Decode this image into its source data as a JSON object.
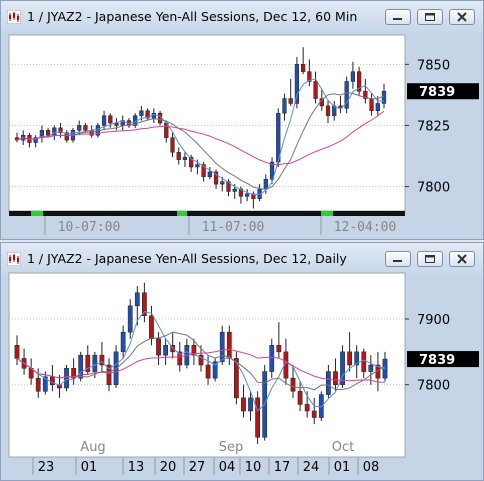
{
  "windows": [
    {
      "title": "1 / JYAZ2 - Japanese Yen-All Sessions, Dec 12, 60 Min",
      "price_labels": [
        "7850",
        "7825",
        "7800"
      ],
      "current_price": "7839",
      "time_labels": [
        "10-07:00",
        "11-07:00",
        "12-04:00"
      ]
    },
    {
      "title": "1 / JYAZ2 - Japanese Yen-All Sessions, Dec 12, Daily",
      "price_labels": [
        "7900",
        "7800"
      ],
      "current_price": "7839",
      "month_labels": [
        "Aug",
        "Sep",
        "Oct"
      ],
      "day_labels": [
        "23",
        "01",
        "13",
        "20",
        "27",
        "04",
        "10",
        "17",
        "24",
        "01",
        "08"
      ]
    }
  ],
  "icons": {
    "minimize": "minimize-icon",
    "maximize": "maximize-icon",
    "close": "close-icon"
  },
  "colors": {
    "up_candle": "#1f4fb0",
    "down_candle": "#b01818",
    "ma_blue": "#5b8fe0",
    "ma_pink": "#d6449a",
    "ma_grey": "#777777",
    "current_price_bg": "#000000",
    "session_green": "#33cc33"
  },
  "chart_data": [
    {
      "type": "candlestick",
      "title": "1 / JYAZ2 - Japanese Yen-All Sessions, Dec 12, 60 Min",
      "ylim": [
        7790,
        7862
      ],
      "yticks": [
        7850,
        7825,
        7800
      ],
      "xticks": [
        "10-07:00",
        "11-07:00",
        "12-04:00"
      ],
      "last": 7839,
      "grid": true,
      "candles": [
        [
          7820,
          7822,
          7818,
          7819
        ],
        [
          7819,
          7823,
          7817,
          7821
        ],
        [
          7821,
          7822,
          7816,
          7818
        ],
        [
          7818,
          7821,
          7816,
          7820
        ],
        [
          7820,
          7825,
          7818,
          7823
        ],
        [
          7823,
          7824,
          7820,
          7821
        ],
        [
          7821,
          7825,
          7819,
          7824
        ],
        [
          7824,
          7826,
          7820,
          7822
        ],
        [
          7822,
          7823,
          7818,
          7819
        ],
        [
          7819,
          7824,
          7818,
          7823
        ],
        [
          7823,
          7827,
          7821,
          7825
        ],
        [
          7825,
          7826,
          7822,
          7823
        ],
        [
          7823,
          7825,
          7820,
          7821
        ],
        [
          7821,
          7826,
          7820,
          7825
        ],
        [
          7825,
          7831,
          7823,
          7829
        ],
        [
          7829,
          7830,
          7824,
          7826
        ],
        [
          7826,
          7828,
          7823,
          7825
        ],
        [
          7825,
          7829,
          7823,
          7827
        ],
        [
          7827,
          7828,
          7824,
          7825
        ],
        [
          7825,
          7830,
          7824,
          7829
        ],
        [
          7829,
          7833,
          7827,
          7831
        ],
        [
          7831,
          7832,
          7827,
          7828
        ],
        [
          7828,
          7832,
          7826,
          7830
        ],
        [
          7830,
          7831,
          7825,
          7826
        ],
        [
          7826,
          7827,
          7818,
          7820
        ],
        [
          7820,
          7822,
          7812,
          7814
        ],
        [
          7814,
          7816,
          7809,
          7811
        ],
        [
          7811,
          7814,
          7808,
          7812
        ],
        [
          7812,
          7813,
          7806,
          7808
        ],
        [
          7808,
          7811,
          7805,
          7809
        ],
        [
          7809,
          7810,
          7802,
          7804
        ],
        [
          7804,
          7808,
          7803,
          7806
        ],
        [
          7806,
          7807,
          7799,
          7801
        ],
        [
          7801,
          7804,
          7798,
          7802
        ],
        [
          7802,
          7803,
          7796,
          7798
        ],
        [
          7798,
          7801,
          7795,
          7799
        ],
        [
          7799,
          7800,
          7793,
          7796
        ],
        [
          7796,
          7799,
          7794,
          7797
        ],
        [
          7797,
          7798,
          7791,
          7795
        ],
        [
          7795,
          7801,
          7794,
          7799
        ],
        [
          7799,
          7805,
          7797,
          7803
        ],
        [
          7803,
          7812,
          7801,
          7810
        ],
        [
          7810,
          7832,
          7808,
          7830
        ],
        [
          7830,
          7838,
          7827,
          7836
        ],
        [
          7836,
          7844,
          7833,
          7834
        ],
        [
          7834,
          7853,
          7832,
          7850
        ],
        [
          7850,
          7857,
          7846,
          7847
        ],
        [
          7847,
          7852,
          7841,
          7843
        ],
        [
          7843,
          7847,
          7834,
          7836
        ],
        [
          7836,
          7840,
          7831,
          7833
        ],
        [
          7833,
          7835,
          7826,
          7829
        ],
        [
          7829,
          7835,
          7827,
          7833
        ],
        [
          7833,
          7837,
          7830,
          7832
        ],
        [
          7832,
          7845,
          7830,
          7843
        ],
        [
          7843,
          7851,
          7840,
          7847
        ],
        [
          7847,
          7849,
          7837,
          7839
        ],
        [
          7839,
          7844,
          7834,
          7836
        ],
        [
          7836,
          7838,
          7829,
          7831
        ],
        [
          7831,
          7837,
          7829,
          7834
        ],
        [
          7834,
          7842,
          7832,
          7839
        ]
      ]
    },
    {
      "type": "candlestick",
      "title": "1 / JYAZ2 - Japanese Yen-All Sessions, Dec 12, Daily",
      "ylim": [
        7690,
        7970
      ],
      "yticks": [
        7900,
        7800
      ],
      "xticks": [
        "23",
        "01",
        "13",
        "20",
        "27",
        "04",
        "10",
        "17",
        "24",
        "01",
        "08"
      ],
      "month_ticks": [
        "Aug",
        "Sep",
        "Oct"
      ],
      "last": 7839,
      "grid": true,
      "candles": [
        [
          7860,
          7875,
          7830,
          7840
        ],
        [
          7840,
          7855,
          7815,
          7825
        ],
        [
          7825,
          7840,
          7800,
          7810
        ],
        [
          7810,
          7825,
          7780,
          7790
        ],
        [
          7790,
          7820,
          7785,
          7812
        ],
        [
          7812,
          7830,
          7790,
          7800
        ],
        [
          7800,
          7815,
          7780,
          7795
        ],
        [
          7795,
          7830,
          7790,
          7825
        ],
        [
          7825,
          7840,
          7800,
          7810
        ],
        [
          7810,
          7850,
          7805,
          7845
        ],
        [
          7845,
          7860,
          7815,
          7820
        ],
        [
          7820,
          7850,
          7810,
          7845
        ],
        [
          7845,
          7865,
          7820,
          7830
        ],
        [
          7830,
          7840,
          7790,
          7800
        ],
        [
          7800,
          7860,
          7795,
          7850
        ],
        [
          7850,
          7890,
          7840,
          7880
        ],
        [
          7880,
          7930,
          7870,
          7920
        ],
        [
          7920,
          7950,
          7890,
          7940
        ],
        [
          7940,
          7955,
          7895,
          7905
        ],
        [
          7905,
          7920,
          7860,
          7870
        ],
        [
          7870,
          7880,
          7830,
          7845
        ],
        [
          7845,
          7870,
          7830,
          7860
        ],
        [
          7860,
          7880,
          7840,
          7850
        ],
        [
          7850,
          7865,
          7820,
          7830
        ],
        [
          7830,
          7870,
          7825,
          7860
        ],
        [
          7860,
          7870,
          7830,
          7845
        ],
        [
          7845,
          7860,
          7820,
          7830
        ],
        [
          7830,
          7845,
          7800,
          7810
        ],
        [
          7810,
          7840,
          7805,
          7835
        ],
        [
          7835,
          7890,
          7830,
          7880
        ],
        [
          7880,
          7890,
          7830,
          7840
        ],
        [
          7840,
          7850,
          7770,
          7780
        ],
        [
          7780,
          7800,
          7750,
          7760
        ],
        [
          7760,
          7790,
          7745,
          7780
        ],
        [
          7780,
          7790,
          7710,
          7720
        ],
        [
          7720,
          7830,
          7715,
          7820
        ],
        [
          7820,
          7870,
          7810,
          7860
        ],
        [
          7860,
          7895,
          7840,
          7850
        ],
        [
          7850,
          7870,
          7800,
          7810
        ],
        [
          7810,
          7830,
          7780,
          7790
        ],
        [
          7790,
          7805,
          7760,
          7770
        ],
        [
          7770,
          7790,
          7750,
          7760
        ],
        [
          7760,
          7780,
          7740,
          7750
        ],
        [
          7750,
          7790,
          7745,
          7785
        ],
        [
          7785,
          7830,
          7780,
          7820
        ],
        [
          7820,
          7840,
          7790,
          7800
        ],
        [
          7800,
          7860,
          7795,
          7850
        ],
        [
          7850,
          7880,
          7820,
          7830
        ],
        [
          7830,
          7860,
          7810,
          7850
        ],
        [
          7850,
          7855,
          7810,
          7820
        ],
        [
          7820,
          7845,
          7800,
          7830
        ],
        [
          7830,
          7850,
          7790,
          7810
        ],
        [
          7810,
          7850,
          7805,
          7839
        ]
      ]
    }
  ]
}
